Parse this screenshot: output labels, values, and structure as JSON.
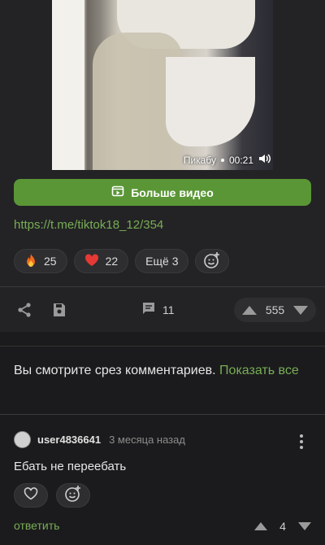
{
  "video": {
    "source": "Пикабу",
    "duration": "00:21"
  },
  "post": {
    "more_video_label": "Больше видео",
    "link": "https://t.me/tiktok18_12/354",
    "reactions": [
      {
        "icon": "fire-icon",
        "count": "25"
      },
      {
        "icon": "heart-icon",
        "count": "22"
      }
    ],
    "more_reactions_label": "Ещё 3",
    "comments_count": "11",
    "rating": "555"
  },
  "notice": {
    "text": "Вы смотрите срез комментариев.",
    "show_all": "Показать все"
  },
  "comment": {
    "username": "user4836641",
    "time_ago": "3 месяца назад",
    "text": "Ебать не переебать",
    "reply_label": "ответить",
    "rating": "4"
  },
  "colors": {
    "accent": "#5a9636",
    "link": "#78ad55",
    "background": "#1b1b1d"
  }
}
